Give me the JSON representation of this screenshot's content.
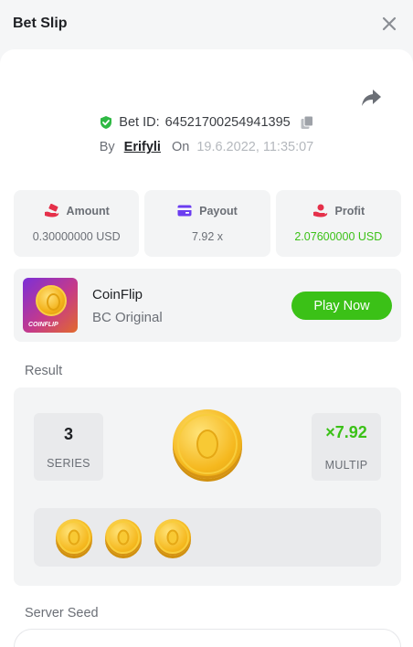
{
  "header": {
    "title": "Bet Slip"
  },
  "bet": {
    "id_label": "Bet ID:",
    "id_value": "64521700254941395",
    "by_label": "By",
    "user": "Erifyli",
    "on_label": "On",
    "date": "19.6.2022, 11:35:07"
  },
  "stats": [
    {
      "label": "Amount",
      "value": "0.30000000 USD",
      "icon": "money-hand-icon"
    },
    {
      "label": "Payout",
      "value": "7.92 x",
      "icon": "card-icon"
    },
    {
      "label": "Profit",
      "value": "2.07600000 USD",
      "icon": "profit-hand-icon"
    }
  ],
  "game": {
    "name": "CoinFlip",
    "subtitle": "BC Original",
    "thumb_text": "COINFLIP",
    "play_label": "Play Now"
  },
  "result": {
    "section_label": "Result",
    "series_value": "3",
    "series_label": "SERIES",
    "multiplier_value": "×7.92",
    "multiplier_label": "MULTIP",
    "history_count": 3
  },
  "server_seed": {
    "label": "Server Seed",
    "value": ""
  },
  "colors": {
    "accent_green": "#3bc117",
    "shield_green": "#2fb944",
    "payout_purple": "#6b3df0",
    "icon_red": "#e5304a",
    "coin_gold": "#f5b81e"
  }
}
